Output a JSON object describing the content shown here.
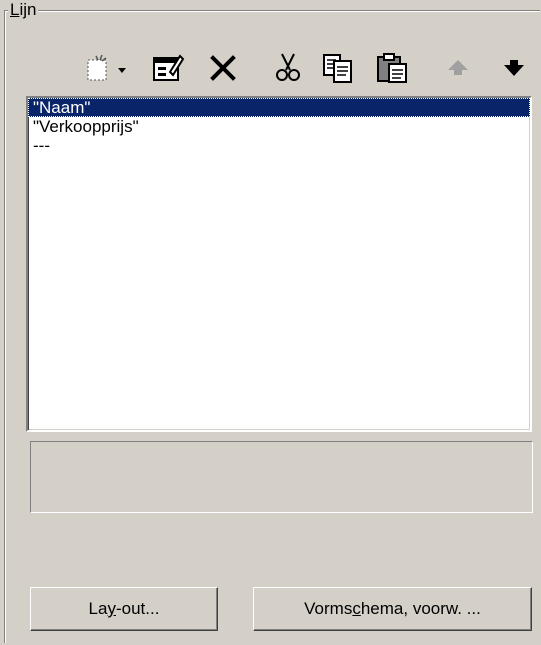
{
  "group": {
    "title_mnemonic": "L",
    "title_rest": "ijn"
  },
  "toolbar": {
    "buttons": [
      {
        "name": "new-item-dropdown",
        "icon": "new-item-icon"
      },
      {
        "name": "properties",
        "icon": "properties-icon"
      },
      {
        "name": "delete",
        "icon": "delete-x-icon"
      },
      {
        "name": "cut",
        "icon": "scissors-icon"
      },
      {
        "name": "copy",
        "icon": "copy-icon"
      },
      {
        "name": "paste",
        "icon": "paste-icon"
      },
      {
        "name": "move-up",
        "icon": "arrow-up-icon",
        "enabled": false
      },
      {
        "name": "move-down",
        "icon": "arrow-down-icon",
        "enabled": true
      }
    ]
  },
  "list": {
    "items": [
      {
        "label": "\"Naam\"",
        "selected": true
      },
      {
        "label": "\"Verkoopprijs\"",
        "selected": false
      },
      {
        "label": "---",
        "selected": false
      }
    ],
    "selection_color": "#0a246a"
  },
  "buttons": {
    "layout_pre": "La",
    "layout_mn": "y",
    "layout_post": "-out...",
    "vorm_pre": "Vorms",
    "vorm_mn": "c",
    "vorm_post": "hema, voorw. ..."
  },
  "colors": {
    "face": "#d4d0c8",
    "disabled_arrow": "#a0a0a0"
  }
}
